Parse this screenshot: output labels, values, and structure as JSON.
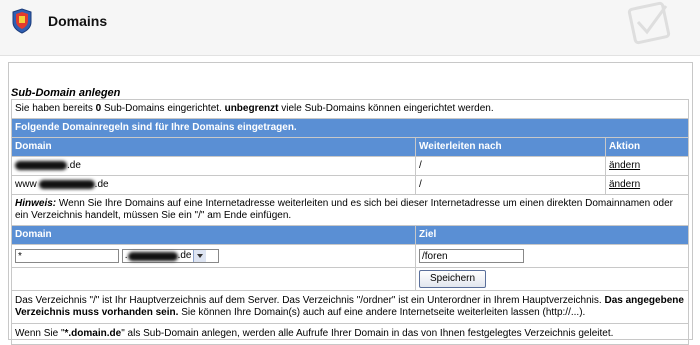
{
  "header": {
    "title": "Domains"
  },
  "section": {
    "title": "Sub-Domain anlegen"
  },
  "info": {
    "prefix": "Sie haben bereits",
    "count": "0",
    "middle": "Sub-Domains eingerichtet.",
    "unlimited": "unbegrenzt",
    "suffix": "viele Sub-Domains können eingerichtet werden."
  },
  "rules_heading": "Folgende Domainregeln sind für Ihre Domains eingetragen.",
  "rules_table": {
    "columns": [
      "Domain",
      "Weiterleiten nach",
      "Aktion"
    ],
    "rows": [
      {
        "domain_prefix": "",
        "domain_suffix": ".de",
        "target": "/",
        "action": "ändern"
      },
      {
        "domain_prefix": "www",
        "domain_suffix": ".de",
        "target": "/",
        "action": "ändern"
      }
    ]
  },
  "hint": {
    "label": "Hinweis:",
    "text": "Wenn Sie Ihre Domains auf eine Internetadresse weiterleiten und es sich bei dieser Internetadresse um einen direkten Domainnamen oder ein Verzeichnis handelt, müssen Sie ein \"/\" am Ende einfügen."
  },
  "form": {
    "col_domain": "Domain",
    "col_target": "Ziel",
    "subdomain_value": "*",
    "domain_select_prefix": ".",
    "domain_select_suffix": ".de",
    "target_value": "/foren",
    "save_label": "Speichern"
  },
  "note1": {
    "text": "Das Verzeichnis \"/\" ist Ihr Hauptverzeichnis auf dem Server. Das Verzeichnis \"/ordner\" ist ein Unterordner in Ihrem Hauptverzeichnis.",
    "bold": "Das angegebene Verzeichnis muss vorhanden sein.",
    "tail": "Sie können Ihre Domain(s) auch auf eine andere Internetseite weiterleiten lassen (http://...)."
  },
  "note2": {
    "prefix": "Wenn Sie \"",
    "bold": "*.domain.de",
    "suffix": "\" als Sub-Domain anlegen, werden alle Aufrufe Ihrer Domain in das von Ihnen festgelegtes Verzeichnis geleitet."
  }
}
